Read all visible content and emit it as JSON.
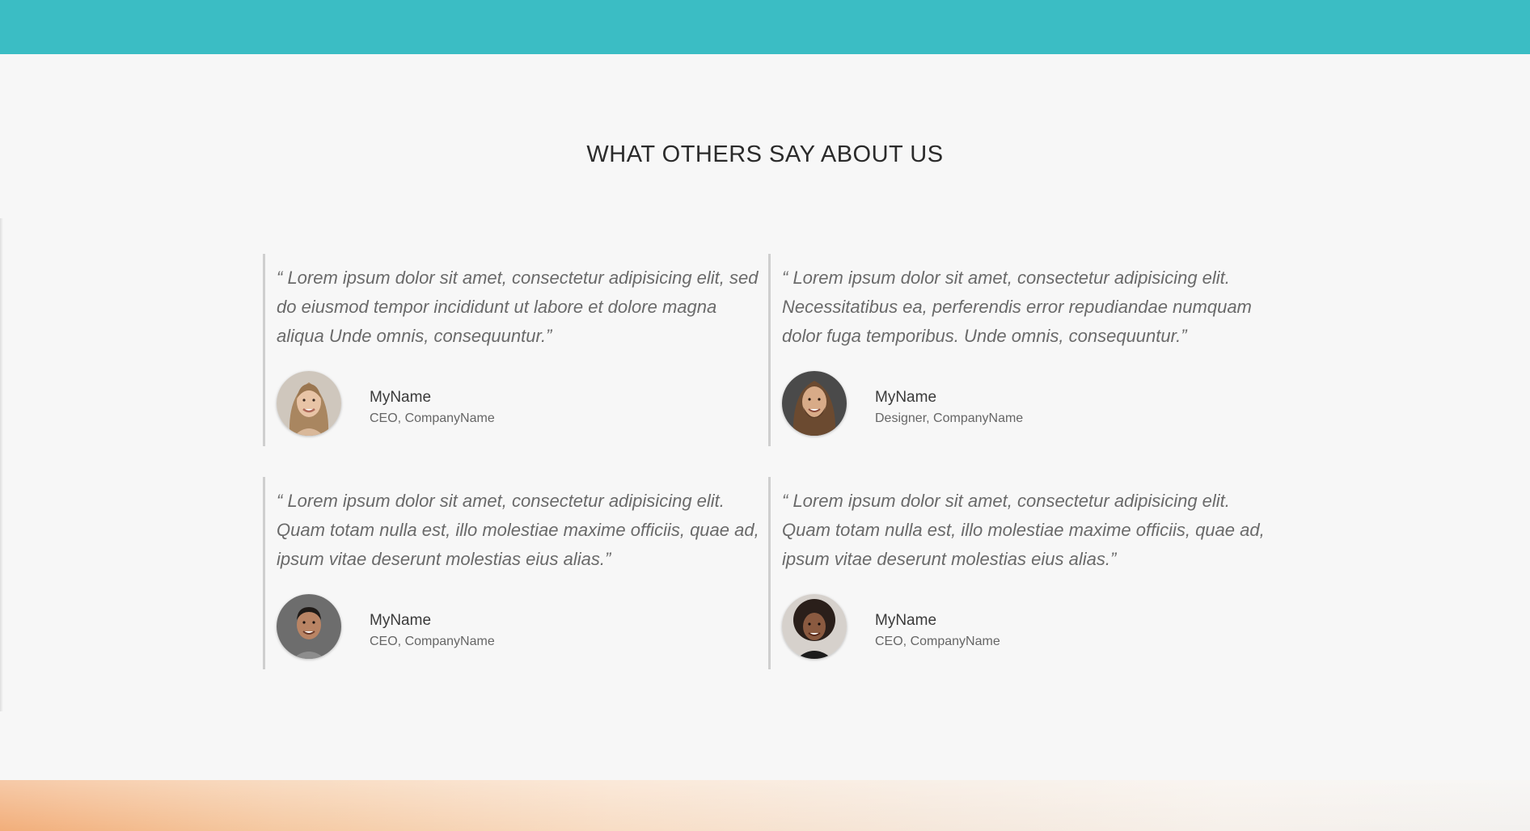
{
  "section": {
    "title": "WHAT OTHERS SAY ABOUT US"
  },
  "testimonials": [
    {
      "quote": "“ Lorem ipsum dolor sit amet, consectetur adipisicing elit, sed do eiusmod tempor incididunt ut labore et dolore magna aliqua Unde omnis, consequuntur.”",
      "name": "MyName",
      "role": "CEO, CompanyName",
      "avatar_icon": "woman-portrait-icon"
    },
    {
      "quote": "“ Lorem ipsum dolor sit amet, consectetur adipisicing elit. Necessitatibus ea, perferendis error repudiandae numquam dolor fuga temporibus. Unde omnis, consequuntur.”",
      "name": "MyName",
      "role": "Designer, CompanyName",
      "avatar_icon": "bearded-man-portrait-icon"
    },
    {
      "quote": "“ Lorem ipsum dolor sit amet, consectetur adipisicing elit. Quam totam nulla est, illo molestiae maxime officiis, quae ad, ipsum vitae deserunt molestias eius alias.”",
      "name": "MyName",
      "role": "CEO, CompanyName",
      "avatar_icon": "man-portrait-icon"
    },
    {
      "quote": "“ Lorem ipsum dolor sit amet, consectetur adipisicing elit. Quam totam nulla est, illo molestiae maxime officiis, quae ad, ipsum vitae deserunt molestias eius alias.”",
      "name": "MyName",
      "role": "CEO, CompanyName",
      "avatar_icon": "curly-hair-woman-portrait-icon"
    }
  ],
  "colors": {
    "top_bar": "#3bbdc4",
    "background": "#f7f7f7",
    "card_border": "#cfcfcf"
  }
}
